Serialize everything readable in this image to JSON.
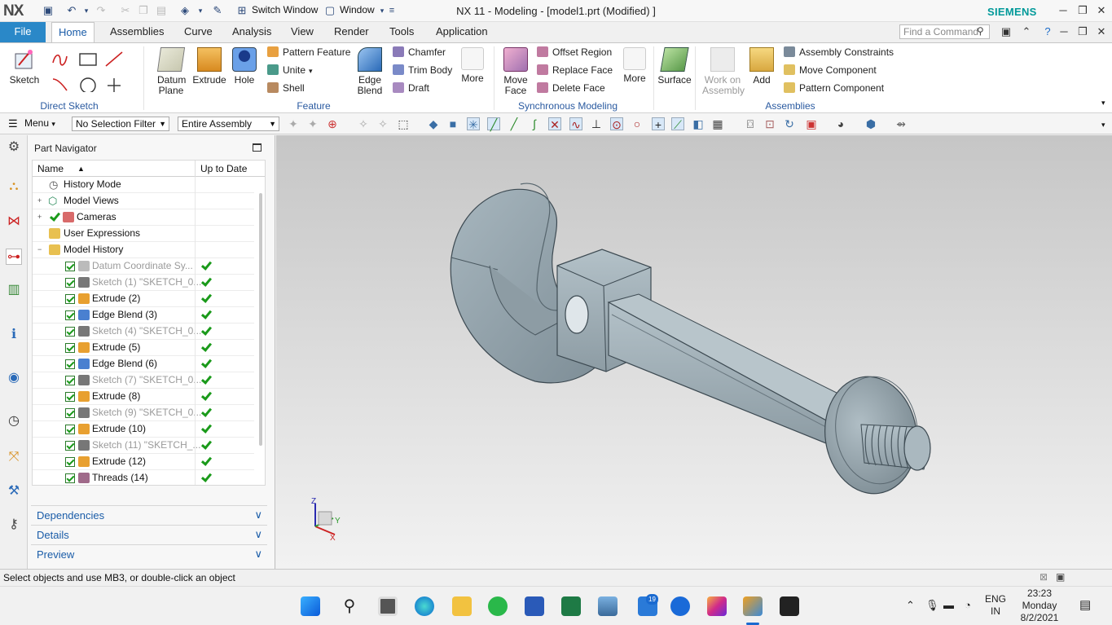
{
  "app": {
    "logo": "NX",
    "title": "NX 11 - Modeling - [model1.prt (Modified) ]",
    "brand": "SIEMENS",
    "quick_access": {
      "switch_window": "Switch Window",
      "window": "Window"
    }
  },
  "menu_tabs": {
    "file": "File",
    "items": [
      "Home",
      "Assemblies",
      "Curve",
      "Analysis",
      "View",
      "Render",
      "Tools",
      "Application"
    ],
    "search_placeholder": "Find a Command"
  },
  "ribbon": {
    "sketch": "Sketch",
    "direct_sketch_group": "Direct Sketch",
    "datum_plane": "Datum Plane",
    "extrude": "Extrude",
    "hole": "Hole",
    "pattern_feature": "Pattern Feature",
    "unite": "Unite",
    "shell": "Shell",
    "edge_blend": "Edge Blend",
    "chamfer": "Chamfer",
    "trim_body": "Trim Body",
    "draft": "Draft",
    "more1": "More",
    "feature_group": "Feature",
    "move_face": "Move Face",
    "offset_region": "Offset Region",
    "replace_face": "Replace Face",
    "delete_face": "Delete Face",
    "more2": "More",
    "sync_group": "Synchronous Modeling",
    "surface": "Surface",
    "work_on_assembly": "Work on Assembly",
    "add": "Add",
    "assembly_constraints": "Assembly Constraints",
    "move_component": "Move Component",
    "pattern_component": "Pattern Component",
    "assemblies_group": "Assemblies"
  },
  "toolbar": {
    "menu": "Menu",
    "selection_filter": "No Selection Filter",
    "scope": "Entire Assembly"
  },
  "navigator": {
    "title": "Part Navigator",
    "col_name": "Name",
    "col_uptodate": "Up to Date",
    "rows": [
      {
        "label": "History Mode",
        "dim": false
      },
      {
        "label": "Model Views",
        "dim": false
      },
      {
        "label": "Cameras",
        "dim": false
      },
      {
        "label": "User Expressions",
        "dim": false
      },
      {
        "label": "Model History",
        "dim": false
      },
      {
        "label": "Datum Coordinate Sy...",
        "dim": true
      },
      {
        "label": "Sketch (1) \"SKETCH_0...",
        "dim": true
      },
      {
        "label": "Extrude (2)",
        "dim": false
      },
      {
        "label": "Edge Blend (3)",
        "dim": false
      },
      {
        "label": "Sketch (4) \"SKETCH_0...",
        "dim": true
      },
      {
        "label": "Extrude (5)",
        "dim": false
      },
      {
        "label": "Edge Blend (6)",
        "dim": false
      },
      {
        "label": "Sketch (7) \"SKETCH_0...",
        "dim": true
      },
      {
        "label": "Extrude (8)",
        "dim": false
      },
      {
        "label": "Sketch (9) \"SKETCH_0...",
        "dim": true
      },
      {
        "label": "Extrude (10)",
        "dim": false
      },
      {
        "label": "Sketch (11) \"SKETCH_...",
        "dim": true
      },
      {
        "label": "Extrude (12)",
        "dim": false
      },
      {
        "label": "Threads (14)",
        "dim": false
      }
    ],
    "panels": {
      "dependencies": "Dependencies",
      "details": "Details",
      "preview": "Preview"
    }
  },
  "viewport": {
    "triad": {
      "z": "Z",
      "y": "Y",
      "x": "X"
    },
    "model_color": "#9aa9b1"
  },
  "status": {
    "text": "Select objects and use MB3, or double-click an object"
  },
  "taskbar": {
    "badge": "19",
    "lang": "ENG",
    "region": "IN",
    "time": "23:23",
    "day": "Monday",
    "date": "8/2/2021"
  }
}
